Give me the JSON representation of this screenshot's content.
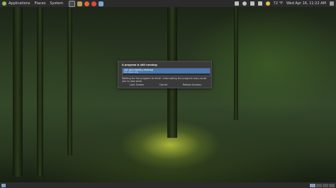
{
  "topbar": {
    "menus": [
      "Applications",
      "Places",
      "System"
    ],
    "temperature": "72 °F",
    "clock": "Wed Apr 16, 11:22 AM"
  },
  "dialog": {
    "title": "A program is still running:",
    "item_name": "ubt-gst-registry-desktop",
    "item_status": "Not responding",
    "message": "Waiting for the program to finish. Interrupting the program may cause you to lose work.",
    "buttons": [
      "Lock Screen",
      "Cancel",
      "Reboot Anyway"
    ]
  },
  "colors": {
    "panel": "#2b2b2b",
    "dialog_bg": "#3a3a3a",
    "selection": "#4a78b0"
  }
}
